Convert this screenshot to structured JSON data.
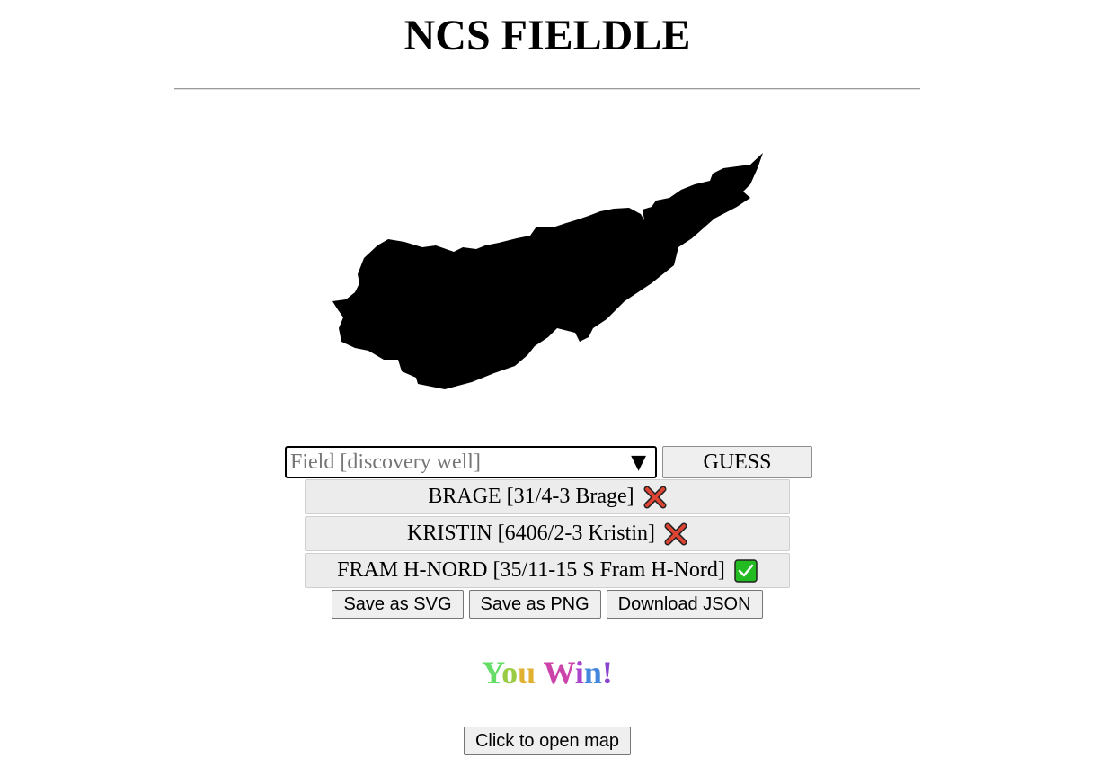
{
  "header": {
    "title": "NCS FIELDLE"
  },
  "guess_form": {
    "placeholder": "Field [discovery well]",
    "value": "",
    "dropdown_icon": "chevron-down-icon",
    "guess_label": "GUESS"
  },
  "guesses": [
    {
      "text": "BRAGE [31/4-3 Brage]",
      "result": "wrong",
      "icon": "cross-icon",
      "color": "#dd4433"
    },
    {
      "text": "KRISTIN [6406/2-3 Kristin]",
      "result": "wrong",
      "icon": "cross-icon",
      "color": "#dd4433"
    },
    {
      "text": "FRAM H-NORD [35/11-15 S Fram H-Nord]",
      "result": "correct",
      "icon": "checkmark-icon",
      "color": "#22bb22"
    }
  ],
  "export": {
    "svg_label": "Save as SVG",
    "png_label": "Save as PNG",
    "json_label": "Download JSON"
  },
  "result": {
    "letters": [
      {
        "char": "Y",
        "color": "#66dd66"
      },
      {
        "char": "o",
        "color": "#99cc44"
      },
      {
        "char": "u",
        "color": "#e0b030"
      },
      {
        "char": " ",
        "color": "#000000"
      },
      {
        "char": "W",
        "color": "#cc44aa"
      },
      {
        "char": "i",
        "color": "#aa44cc"
      },
      {
        "char": "n",
        "color": "#4488dd"
      },
      {
        "char": "!",
        "color": "#8844cc"
      }
    ]
  },
  "map": {
    "open_label": "Click to open map"
  }
}
